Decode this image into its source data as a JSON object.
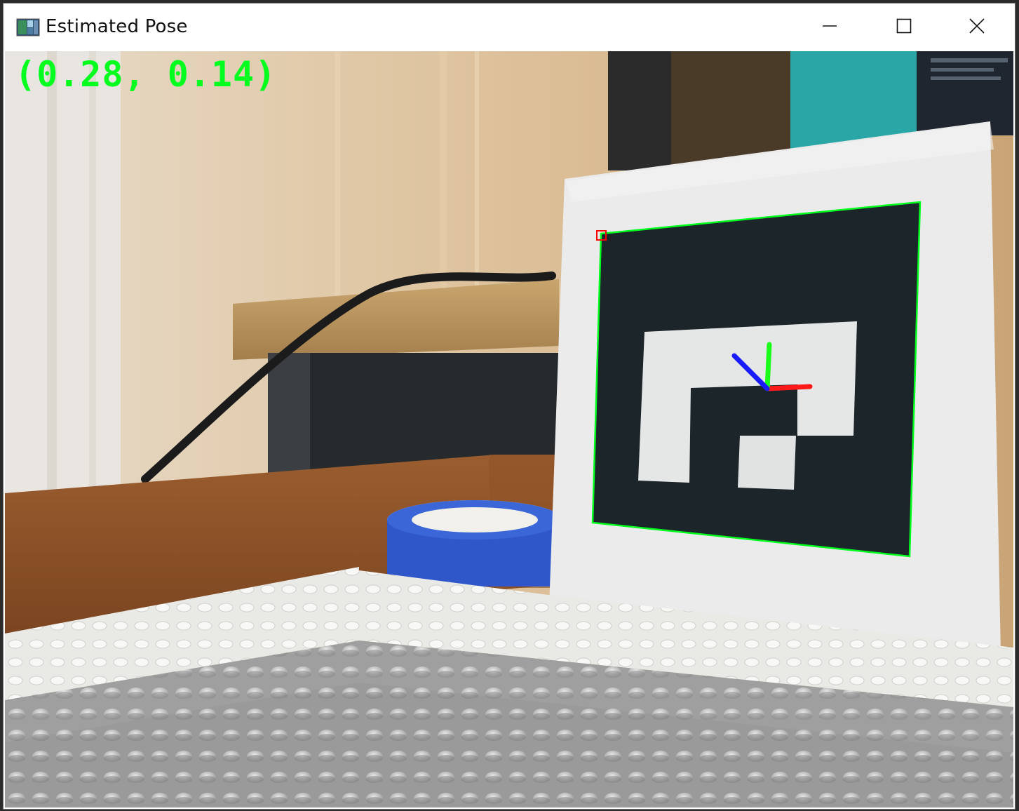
{
  "window": {
    "title": "Estimated Pose",
    "controls": {
      "minimize": "minimize-icon",
      "maximize": "maximize-icon",
      "close": "close-icon"
    }
  },
  "overlay": {
    "position_text": "(0.28, 0.14)",
    "text_color": "#00ff1e"
  },
  "scene": {
    "marker_outline_color": "#00ff1e",
    "corner_marker_color": "#ff0000",
    "axes": {
      "x_color": "#ff1a1a",
      "y_color": "#1aff1a",
      "z_color": "#1a1aff"
    }
  }
}
